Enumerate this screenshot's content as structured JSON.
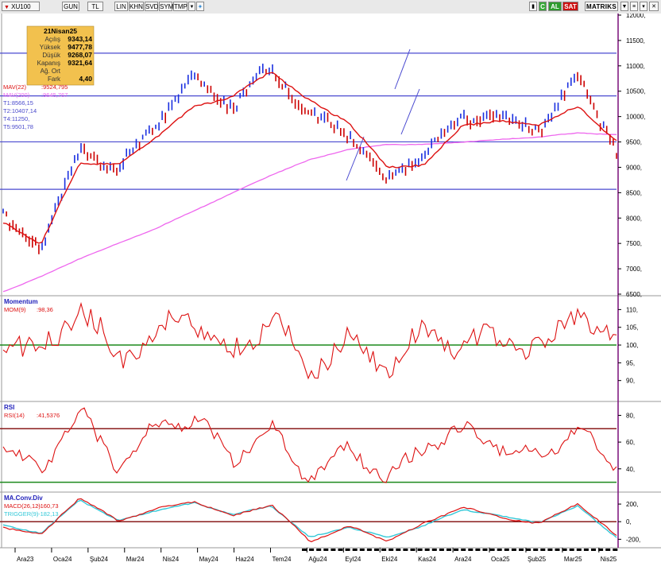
{
  "toolbar": {
    "symbol": "XU100",
    "period": "GUN",
    "currency": "TL",
    "scales": [
      "LIN",
      "KHN"
    ],
    "modes": [
      "SVD",
      "SYM",
      "TMP"
    ],
    "right_buttons": [
      "C",
      "AL",
      "SAT"
    ],
    "matriks": "MATRIKS",
    "colors": {
      "al": "#2e9b2e",
      "sat": "#cc1111",
      "c": "#3aa83a"
    }
  },
  "info_box": {
    "date": "21Nisan25",
    "rows": [
      {
        "label": "Açılış",
        "value": "9343,14"
      },
      {
        "label": "Yüksek",
        "value": "9477,78"
      },
      {
        "label": "Düşük",
        "value": "9268,07"
      },
      {
        "label": "Kapanış",
        "value": "9321,64"
      },
      {
        "label": "Ağ. Ort",
        "value": ""
      },
      {
        "label": "Fark",
        "value": "4,40"
      }
    ],
    "bg": "#f2c14e"
  },
  "overlays": [
    {
      "label": "MAV(22)",
      "value": ":9524,795",
      "color": "#dd1111"
    },
    {
      "label": "MAV(200)",
      "value": ":9645,767",
      "color": "#ee66ee"
    },
    {
      "label": "T1:8566,15",
      "value": "",
      "color": "#4a4acc"
    },
    {
      "label": "T2:10407,14",
      "value": "",
      "color": "#4a4acc"
    },
    {
      "label": "T4:11250,",
      "value": "",
      "color": "#4a4acc"
    },
    {
      "label": "T5:9501,78",
      "value": "",
      "color": "#4a4acc"
    }
  ],
  "momentum_panel": {
    "title": "Momentum",
    "label": "MOM(9)",
    "value": ":98,36"
  },
  "rsi_panel": {
    "title": "RSI",
    "label": "RSI(14)",
    "value": ":41,5376"
  },
  "macd_panel": {
    "title": "MA.Conv.Div",
    "label": "MACD(26,12)",
    "value": ":-160,73",
    "trigger_label": "TRIGGER(9)",
    "trigger_value": ":-182,13"
  },
  "x_axis": [
    "Ara23",
    "Oca24",
    "Şub24",
    "Mar24",
    "Nis24",
    "May24",
    "Haz24",
    "Tem24",
    "Ağu24",
    "Eyl24",
    "Eki24",
    "Kas24",
    "Ara24",
    "Oca25",
    "Şub25",
    "Mar25",
    "Nis25"
  ],
  "chart_data": [
    {
      "type": "line",
      "title": "XU100",
      "ylim": [
        6500,
        12000
      ],
      "y_ticks": [
        "12000,",
        "11500,",
        "11000,",
        "10500,",
        "10000,",
        "9500,",
        "9000,",
        "8500,",
        "8000,",
        "7500,",
        "7000,",
        "6500,"
      ],
      "x": [
        "Ara23",
        "Oca24",
        "Şub24",
        "Mar24",
        "Nis24",
        "May24",
        "Haz24",
        "Tem24",
        "Ağu24",
        "Eyl24",
        "Eki24",
        "Kas24",
        "Ara24",
        "Oca25",
        "Şub25",
        "Mar25",
        "Nis25"
      ],
      "series": [
        {
          "name": "XU100",
          "values": [
            8000,
            7400,
            9350,
            8900,
            9900,
            10750,
            10200,
            11000,
            10000,
            9700,
            8750,
            9300,
            10000,
            9950,
            9750,
            10800,
            9320
          ]
        },
        {
          "name": "MAV(22)",
          "values": [
            7900,
            7500,
            9100,
            9050,
            9600,
            10200,
            10400,
            10900,
            10300,
            9900,
            9000,
            9050,
            9850,
            9900,
            9850,
            10200,
            9520
          ]
        },
        {
          "name": "MAV(200)",
          "values": [
            6550,
            6850,
            7200,
            7500,
            7800,
            8150,
            8500,
            8850,
            9150,
            9350,
            9450,
            9450,
            9500,
            9550,
            9600,
            9680,
            9640
          ]
        }
      ],
      "h_lines": [
        {
          "label": "T1",
          "value": 8566.15
        },
        {
          "label": "T2",
          "value": 10407.14
        },
        {
          "label": "T4",
          "value": 11250
        },
        {
          "label": "T5",
          "value": 9501.78
        }
      ]
    },
    {
      "type": "line",
      "title": "Momentum",
      "ylim": [
        85,
        113
      ],
      "y_ticks": [
        "110,",
        "105,",
        "100,",
        "95,",
        "90,"
      ],
      "reference": 100,
      "series": [
        {
          "name": "MOM(9)",
          "values": [
            103,
            97,
            111,
            96,
            104,
            108,
            97,
            109,
            92,
            103,
            93,
            104,
            100,
            102,
            98,
            111,
            98.36
          ]
        }
      ]
    },
    {
      "type": "line",
      "title": "RSI",
      "ylim": [
        25,
        88
      ],
      "y_ticks": [
        "80,",
        "60,",
        "40,"
      ],
      "bands": [
        70,
        30
      ],
      "series": [
        {
          "name": "RSI(14)",
          "values": [
            55,
            38,
            82,
            42,
            72,
            78,
            48,
            70,
            32,
            58,
            30,
            58,
            70,
            56,
            50,
            72,
            41.54
          ]
        }
      ]
    },
    {
      "type": "line",
      "title": "MA.Conv.Div",
      "ylim": [
        -260,
        300
      ],
      "y_ticks": [
        "200,",
        "0,",
        "-200,"
      ],
      "reference": 0,
      "series": [
        {
          "name": "MACD(26,12)",
          "values": [
            -60,
            -150,
            280,
            0,
            150,
            230,
            60,
            200,
            -230,
            -50,
            -220,
            -20,
            170,
            40,
            -20,
            210,
            -160.73
          ]
        },
        {
          "name": "TRIGGER(9)",
          "values": [
            -40,
            -130,
            250,
            10,
            130,
            210,
            80,
            180,
            -180,
            -60,
            -180,
            -40,
            140,
            60,
            -10,
            180,
            -182.13
          ]
        }
      ]
    }
  ]
}
